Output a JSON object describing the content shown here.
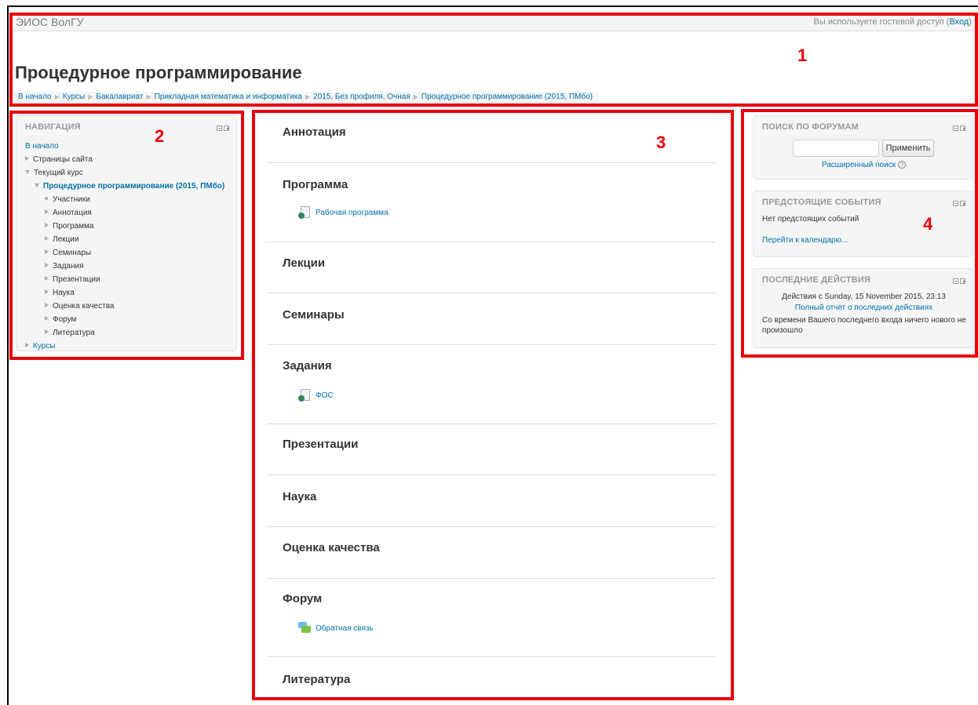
{
  "header": {
    "site_name": "ЭИОС ВолГУ",
    "login_text": "Вы используете гостевой доступ (",
    "login_link": "Вход",
    "login_close": ")",
    "page_title": "Процедурное программирование"
  },
  "breadcrumb": [
    "В начало",
    "Курсы",
    "Бакалавриат",
    "Прикладная математика и информатика",
    "2015, Без профиля, Очная",
    "Процедурное программирование (2015, ПМбо)"
  ],
  "navigation": {
    "title": "НАВИГАЦИЯ",
    "home": "В начало",
    "site_pages": "Страницы сайта",
    "current_course": "Текущий курс",
    "course_name": "Процедурное программирование (2015, ПМбо)",
    "course_items": [
      "Участники",
      "Аннотация",
      "Программа",
      "Лекции",
      "Семинары",
      "Задания",
      "Презентации",
      "Наука",
      "Оценка качества",
      "Форум",
      "Литература"
    ],
    "courses": "Курсы"
  },
  "sections": [
    {
      "title": "Аннотация",
      "activities": []
    },
    {
      "title": "Программа",
      "activities": [
        {
          "label": "Рабочая программа",
          "icon": "resource-page-icon"
        }
      ]
    },
    {
      "title": "Лекции",
      "activities": []
    },
    {
      "title": "Семинары",
      "activities": []
    },
    {
      "title": "Задания",
      "activities": [
        {
          "label": "ФОС",
          "icon": "resource-page-icon"
        }
      ]
    },
    {
      "title": "Презентации",
      "activities": []
    },
    {
      "title": "Наука",
      "activities": []
    },
    {
      "title": "Оценка качества",
      "activities": []
    },
    {
      "title": "Форум",
      "activities": [
        {
          "label": "Обратная связь",
          "icon": "forum-icon"
        }
      ]
    },
    {
      "title": "Литература",
      "activities": []
    }
  ],
  "search_forums": {
    "title": "ПОИСК ПО ФОРУМАМ",
    "input_value": "",
    "button": "Применить",
    "advanced": "Расширенный поиск",
    "help_glyph": "?"
  },
  "upcoming_events": {
    "title": "ПРЕДСТОЯЩИЕ СОБЫТИЯ",
    "none": "Нет предстоящих событий",
    "calendar_link": "Перейти к календарю..."
  },
  "recent_activity": {
    "title": "ПОСЛЕДНИЕ ДЕЙСТВИЯ",
    "since": "Действия с Sunday, 15 November 2015, 23:13",
    "full_report": "Полный отчет о последних действиях",
    "nothing_new": "Со времени Вашего последнего входа ничего нового не произошло"
  },
  "annotations": [
    "1",
    "2",
    "3",
    "4"
  ],
  "colors": {
    "annotation_red": "#e8000b",
    "link_blue": "#0070a8",
    "block_bg": "#f5f5f5"
  }
}
